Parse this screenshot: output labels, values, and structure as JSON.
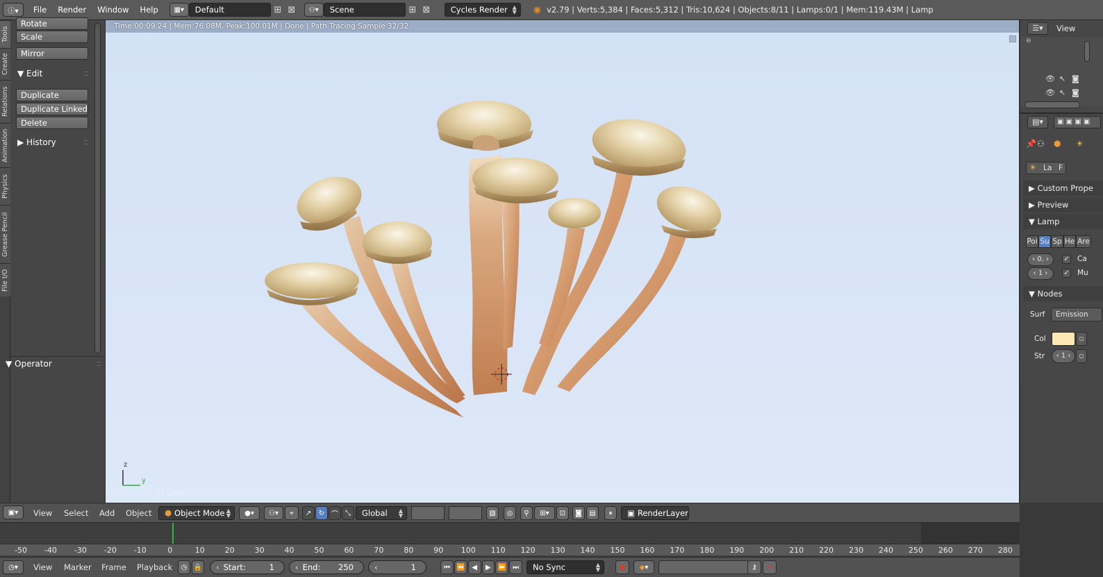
{
  "topbar": {
    "menus": [
      "File",
      "Render",
      "Window",
      "Help"
    ],
    "screen_layout": "Default",
    "scene": "Scene",
    "render_engine": "Cycles Render",
    "stats": "v2.79 | Verts:5,384 | Faces:5,312 | Tris:10,624 | Objects:8/11 | Lamps:0/1 | Mem:119.43M | Lamp"
  },
  "tabs": [
    "Tools",
    "Create",
    "Relations",
    "Animation",
    "Physics",
    "Grease Pencil",
    "File I/O"
  ],
  "toolshelf": {
    "transform_buttons": [
      "Rotate",
      "Scale"
    ],
    "mirror": "Mirror",
    "edit_header": "Edit",
    "edit_buttons": [
      "Duplicate",
      "Duplicate Linked",
      "Delete"
    ],
    "history_header": "History",
    "operator_header": "Operator"
  },
  "viewport": {
    "render_status": "Time:00:09.24 | Mem:76.08M, Peak:100.01M | Done | Path Tracing Sample 32/32",
    "object_label": "(1) Lamp",
    "axis_z": "z",
    "axis_y": "y"
  },
  "outliner": {
    "view_label": "View"
  },
  "properties": {
    "context_short": "La",
    "context_f": "F",
    "custom_props": "Custom Prope",
    "preview": "Preview",
    "lamp": "Lamp",
    "lamp_types": [
      "Poi",
      "Su",
      "Sp",
      "He",
      "Are"
    ],
    "lamp_value_1": "0.",
    "lamp_value_2": "1",
    "check_1": "Ca",
    "check_2": "Mu",
    "nodes": "Nodes",
    "surface_label": "Surf",
    "surface_value": "Emission",
    "color_label": "Col",
    "strength_label": "Str",
    "strength_value": "1",
    "lamp_color": "#fde8b4"
  },
  "view_header": {
    "menus": [
      "View",
      "Select",
      "Add",
      "Object"
    ],
    "mode": "Object Mode",
    "orientation": "Global",
    "render_layer": "RenderLayer"
  },
  "timeline": {
    "ticks": [
      "-50",
      "-40",
      "-30",
      "-20",
      "-10",
      "0",
      "10",
      "20",
      "30",
      "40",
      "50",
      "60",
      "70",
      "80",
      "90",
      "100",
      "110",
      "120",
      "130",
      "140",
      "150",
      "160",
      "170",
      "180",
      "190",
      "200",
      "210",
      "220",
      "230",
      "240",
      "250",
      "260",
      "270",
      "280"
    ],
    "menus": [
      "View",
      "Marker",
      "Frame",
      "Playback"
    ],
    "start_label": "Start:",
    "start_value": "1",
    "end_label": "End:",
    "end_value": "250",
    "current_frame": "1",
    "sync": "No Sync"
  }
}
